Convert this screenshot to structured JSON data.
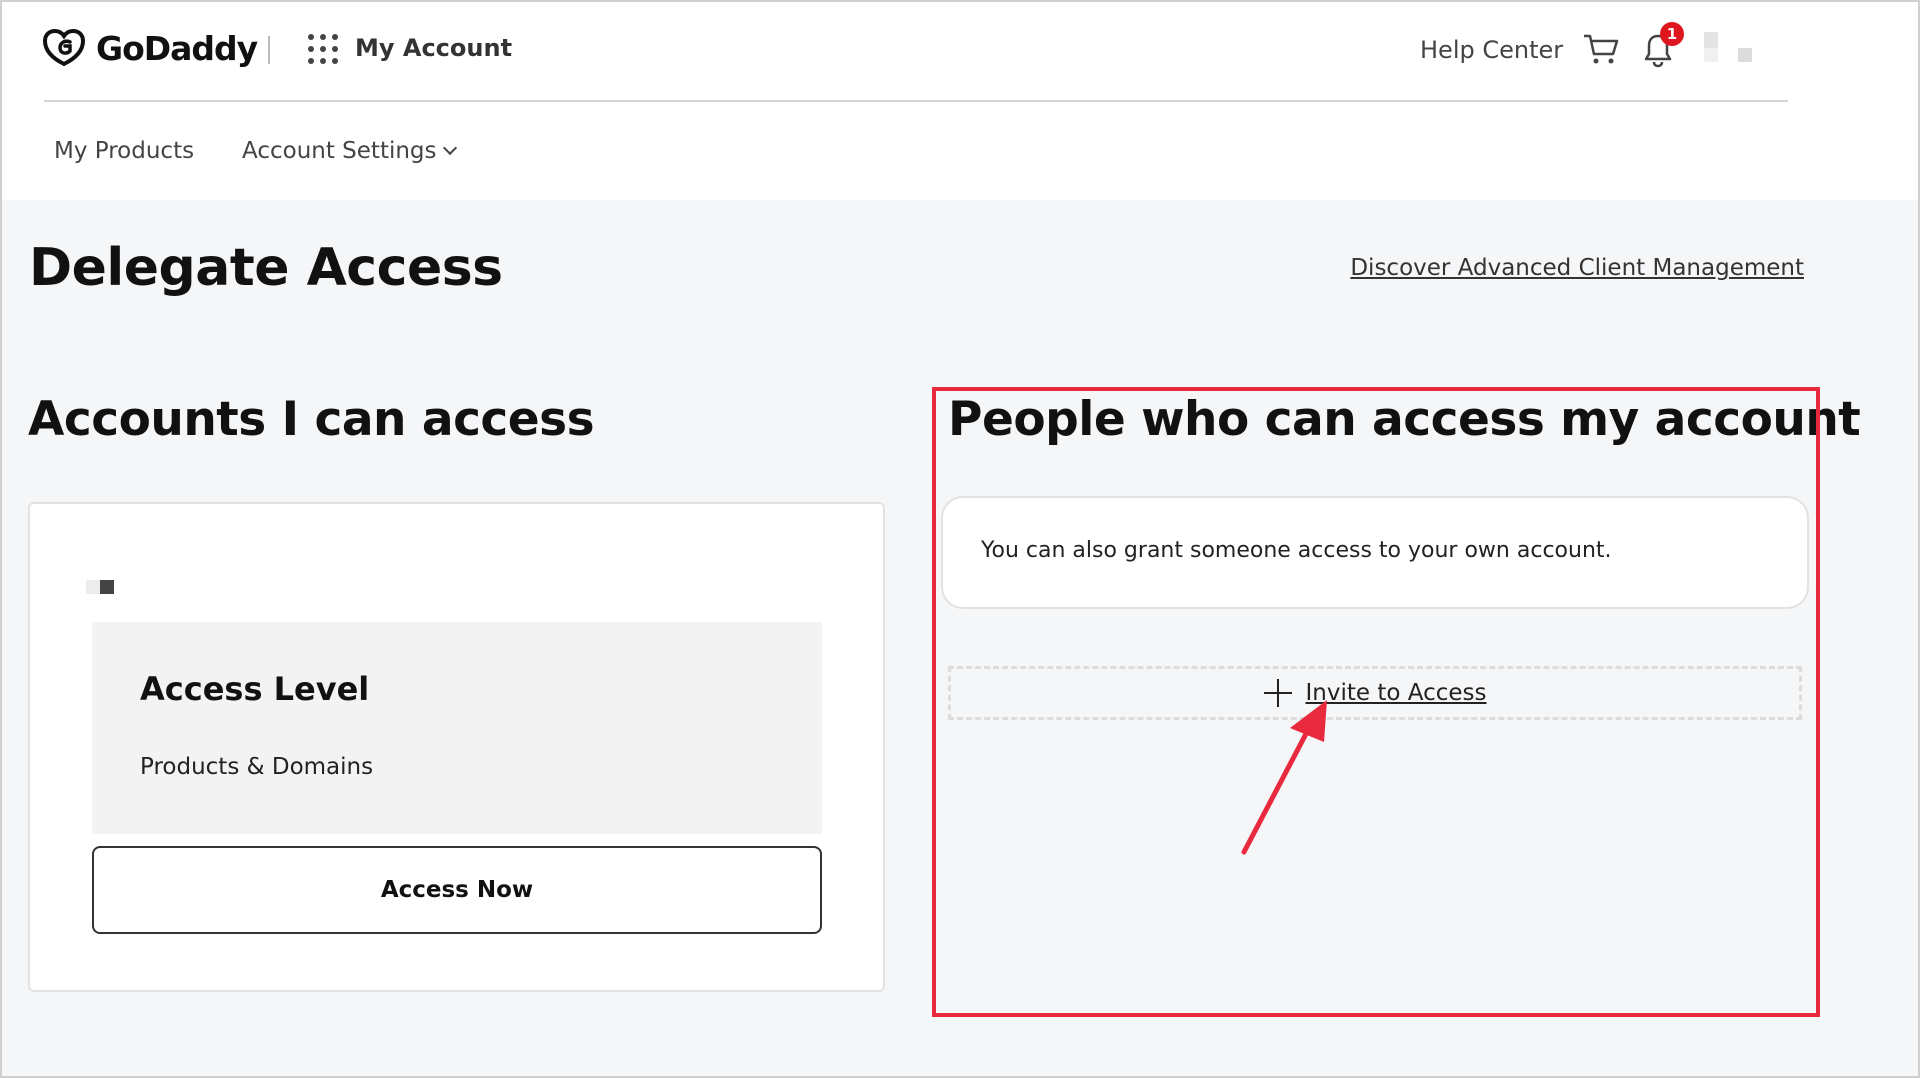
{
  "header": {
    "brand": "GoDaddy",
    "section": "My Account",
    "help": "Help Center",
    "notification_count": "1",
    "accent": "#e0161e"
  },
  "subnav": {
    "items": [
      {
        "label": "My Products"
      },
      {
        "label": "Account Settings"
      }
    ]
  },
  "page": {
    "title": "Delegate Access",
    "discover_link": "Discover Advanced Client Management"
  },
  "accounts_section": {
    "title": "Accounts I can access",
    "card": {
      "level_label": "Access Level",
      "level_value": "Products & Domains",
      "button": "Access Now"
    }
  },
  "people_section": {
    "title": "People who can access my account",
    "grant_text": "You can also grant someone access to your own account.",
    "invite_label": "Invite to Access"
  },
  "annotation": {
    "color": "#e8293e"
  }
}
